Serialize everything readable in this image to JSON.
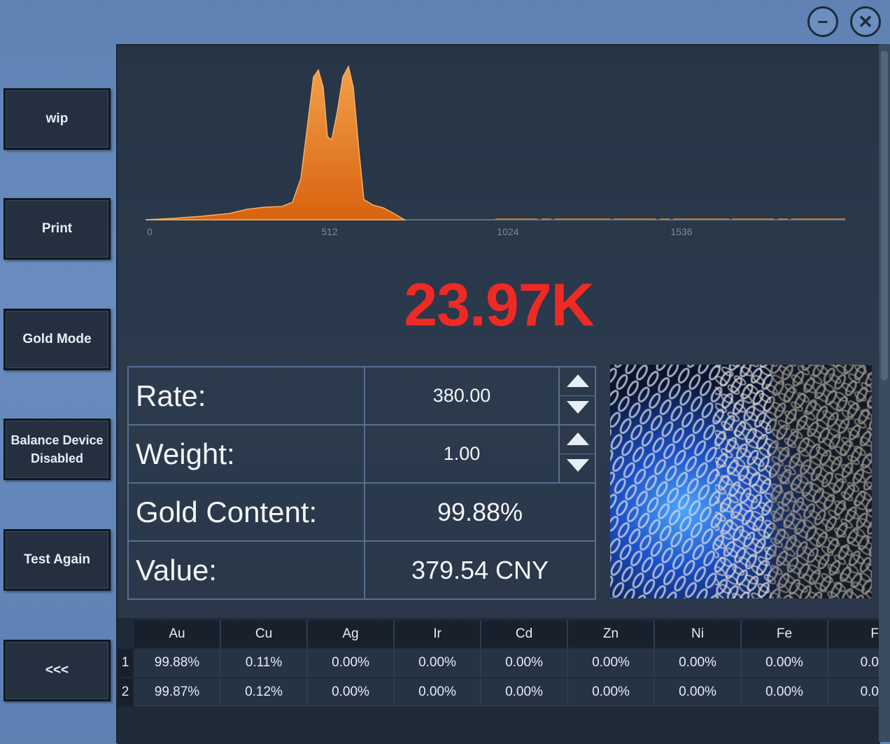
{
  "window": {
    "minimize_icon": "minus-icon",
    "close_icon": "close-icon"
  },
  "sidebar": {
    "buttons": [
      {
        "label": "wip"
      },
      {
        "label": "Print"
      },
      {
        "label": "Gold Mode"
      },
      {
        "label": "Balance Device Disabled"
      },
      {
        "label": "Test Again"
      },
      {
        "label": "<<<"
      }
    ]
  },
  "spectrum": {
    "ticks": [
      "0",
      "512",
      "1024",
      "1536"
    ],
    "color": "#e8781a"
  },
  "result": {
    "karat": "23.97K",
    "color": "#ef2a24"
  },
  "info": {
    "rate_label": "Rate:",
    "rate_value": "380.00",
    "weight_label": "Weight:",
    "weight_value": "1.00",
    "gold_label": "Gold Content:",
    "gold_value": "99.88%",
    "value_label": "Value:",
    "value_value": "379.54 CNY"
  },
  "elements": {
    "headers": [
      "Au",
      "Cu",
      "Ag",
      "Ir",
      "Cd",
      "Zn",
      "Ni",
      "Fe",
      "F"
    ],
    "rows": [
      {
        "num": "1",
        "cells": [
          "99.88%",
          "0.11%",
          "0.00%",
          "0.00%",
          "0.00%",
          "0.00%",
          "0.00%",
          "0.00%",
          "0.0"
        ]
      },
      {
        "num": "2",
        "cells": [
          "99.87%",
          "0.12%",
          "0.00%",
          "0.00%",
          "0.00%",
          "0.00%",
          "0.00%",
          "0.00%",
          "0.0"
        ]
      }
    ]
  }
}
